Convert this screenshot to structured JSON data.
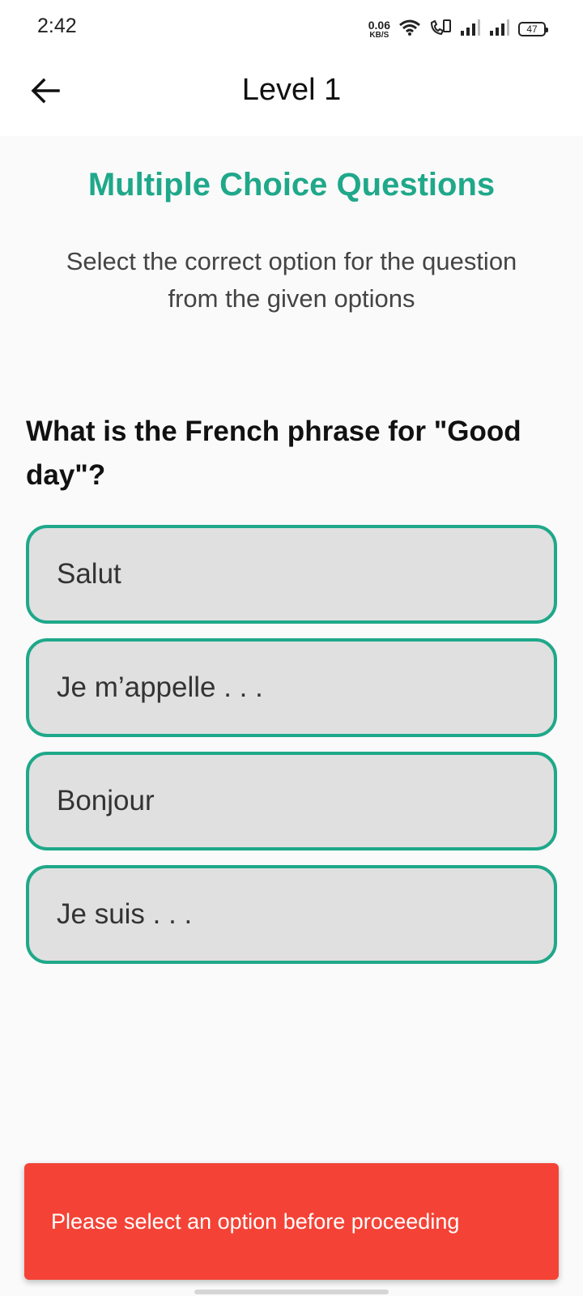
{
  "status_bar": {
    "time": "2:42",
    "net_speed_value": "0.06",
    "net_speed_unit": "KB/S",
    "battery": "47",
    "icons": [
      "wifi-icon",
      "wifi-calling-icon",
      "signal-icon",
      "signal-icon",
      "battery-icon"
    ]
  },
  "app_bar": {
    "title": "Level 1",
    "back_icon": "arrow-left-icon"
  },
  "content": {
    "section_title": "Multiple Choice Questions",
    "section_subtitle": "Select the correct option for the question from the given options",
    "question": "What is the French phrase for \"Good day\"?",
    "options": [
      "Salut",
      "Je m’appelle . . .",
      "Bonjour",
      "Je suis . . ."
    ]
  },
  "snackbar": {
    "message": "Please select an option before proceeding"
  },
  "colors": {
    "accent": "#1fa88a",
    "option_background": "#e0e0e0",
    "error": "#f44336",
    "background": "#fafafa"
  }
}
